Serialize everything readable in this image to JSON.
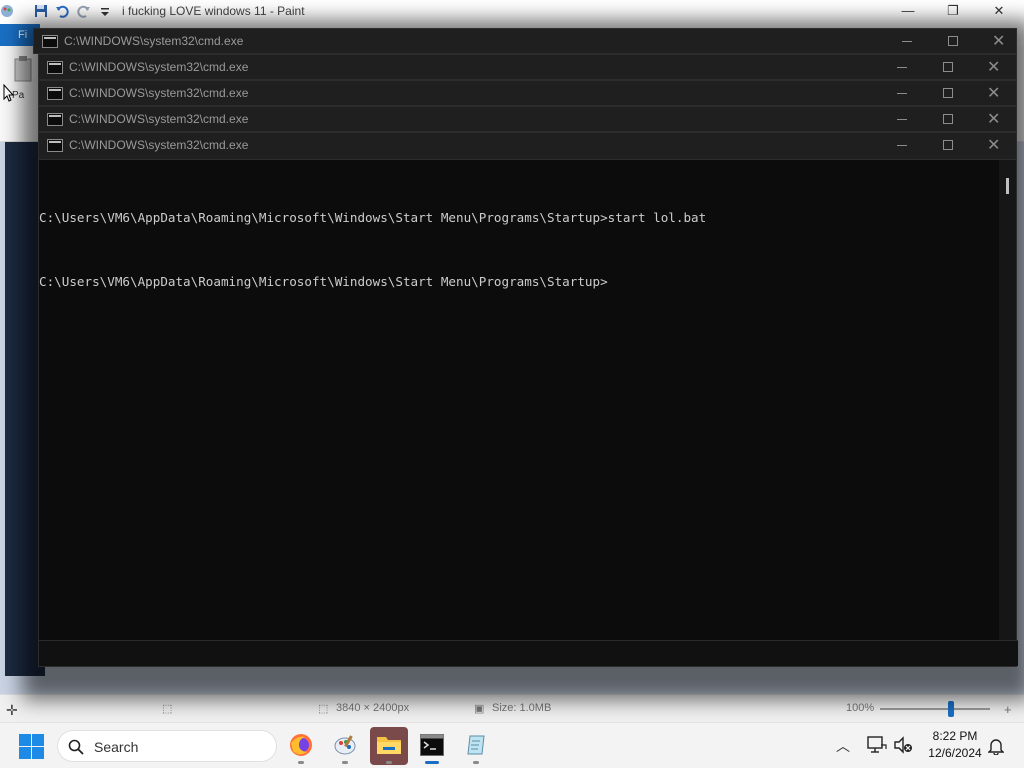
{
  "paint": {
    "title": "i fucking LOVE windows 11 - Paint",
    "file_tab": "Fi",
    "paste_label": "Pa",
    "status": {
      "dimensions": "3840 × 2400px",
      "size": "Size: 1.0MB",
      "zoom": "100%",
      "zoom_level_percent": 100
    }
  },
  "cmd_windows": [
    {
      "title": "C:\\WINDOWS\\system32\\cmd.exe"
    },
    {
      "title": "C:\\WINDOWS\\system32\\cmd.exe"
    },
    {
      "title": "C:\\WINDOWS\\system32\\cmd.exe"
    },
    {
      "title": "C:\\WINDOWS\\system32\\cmd.exe"
    },
    {
      "title": "C:\\WINDOWS\\system32\\cmd.exe"
    }
  ],
  "console": {
    "lines": [
      "C:\\Users\\VM6\\AppData\\Roaming\\Microsoft\\Windows\\Start Menu\\Programs\\Startup>start lol.bat",
      "C:\\Users\\VM6\\AppData\\Roaming\\Microsoft\\Windows\\Start Menu\\Programs\\Startup>"
    ]
  },
  "taskbar": {
    "search_placeholder": "Search",
    "apps": [
      "firefox-icon",
      "paint-icon",
      "file-explorer-icon",
      "terminal-icon",
      "notepad-icon"
    ],
    "active_app": "terminal-icon",
    "time": "8:22 PM",
    "date": "12/6/2024"
  },
  "colors": {
    "console_bg": "#0c0c0c",
    "console_text": "#cccccc",
    "accent": "#1a6fc4"
  }
}
